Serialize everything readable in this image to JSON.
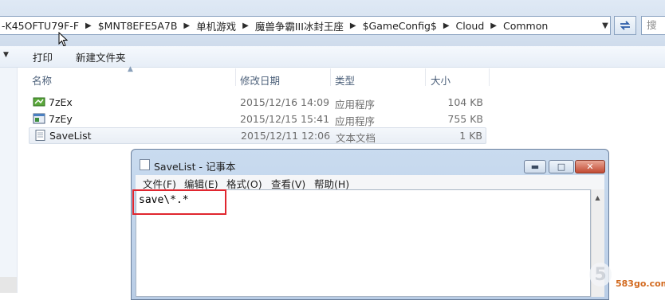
{
  "address_bar": {
    "crumbs": [
      "-K45OFTU79F-F",
      "$MNT8EFE5A7B",
      "单机游戏",
      "魔兽争霸III冰封王座",
      "$GameConfig$",
      "Cloud",
      "Common"
    ],
    "search_placeholder": "搜"
  },
  "toolbar": {
    "print_label": "打印",
    "new_folder_label": "新建文件夹"
  },
  "columns": {
    "name": "名称",
    "date": "修改日期",
    "type": "类型",
    "size": "大小"
  },
  "files": [
    {
      "name": "7zEx",
      "date": "2015/12/16 14:09",
      "type": "应用程序",
      "size": "104 KB",
      "icon": "app-icon"
    },
    {
      "name": "7zEy",
      "date": "2015/12/15 15:41",
      "type": "应用程序",
      "size": "755 KB",
      "icon": "app-window-icon"
    },
    {
      "name": "SaveList",
      "date": "2015/12/11 12:06",
      "type": "文本文档",
      "size": "1 KB",
      "icon": "text-file-icon"
    }
  ],
  "notepad": {
    "title": "SaveList - 记事本",
    "menus": [
      "文件(F)",
      "编辑(E)",
      "格式(O)",
      "查看(V)",
      "帮助(H)"
    ],
    "content": "save\\*.*"
  },
  "watermark": {
    "text": "583go.com"
  },
  "colors": {
    "highlight": "#e0262f",
    "watermark": "#d2691e"
  }
}
